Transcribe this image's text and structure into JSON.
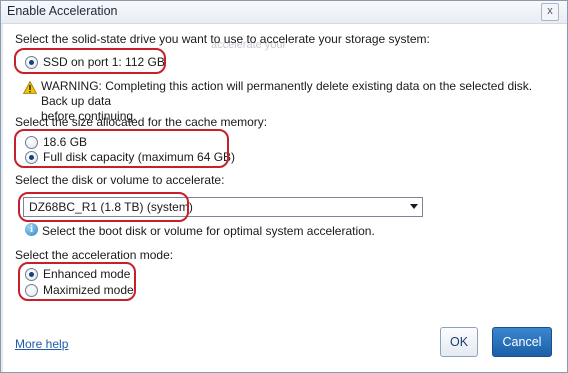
{
  "window": {
    "title": "Enable Acceleration",
    "close_label": "x"
  },
  "ghost_text": "accelerate your",
  "ssd_section": {
    "heading": "Select the solid-state drive you want to use to accelerate your storage system:",
    "option": "SSD on port 1: 112 GB",
    "warning_line1": "WARNING: Completing this action will permanently delete existing data on the selected disk. Back up data",
    "warning_line2": "before continuing."
  },
  "cache_section": {
    "heading": "Select the size allocated for the cache memory:",
    "options": [
      "18.6 GB",
      "Full disk capacity (maximum 64 GB)"
    ],
    "selected_index": 1
  },
  "volume_section": {
    "heading": "Select the disk or volume to accelerate:",
    "selected": "DZ68BC_R1 (1.8 TB) (system)",
    "hint": "Select the boot disk or volume for optimal system acceleration."
  },
  "mode_section": {
    "heading": "Select the acceleration mode:",
    "options": [
      "Enhanced mode",
      "Maximized mode"
    ],
    "selected_index": 0
  },
  "footer": {
    "help_link": "More help",
    "ok_label": "OK",
    "cancel_label": "Cancel"
  },
  "colors": {
    "highlight": "#c8202a",
    "primary_button": "#1b5fa8",
    "link": "#1e5ba8"
  }
}
